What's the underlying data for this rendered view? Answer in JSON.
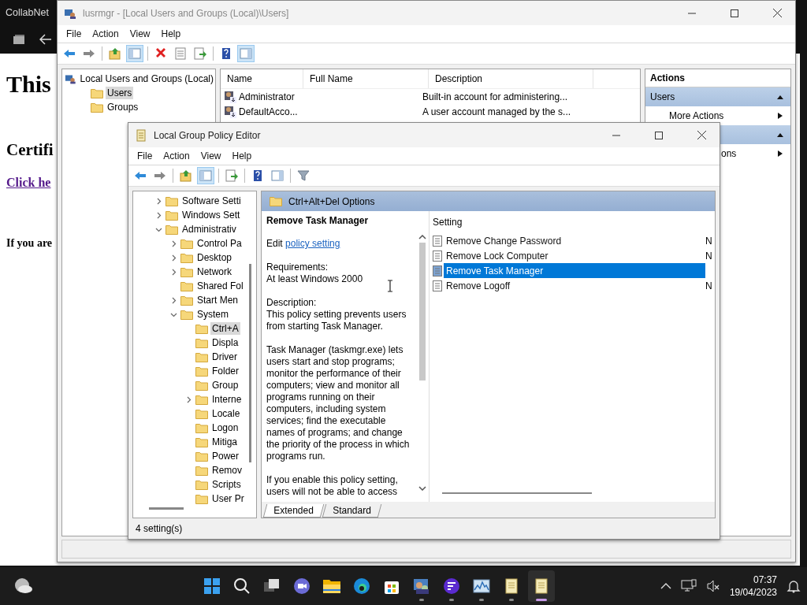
{
  "browser": {
    "tab_title": "CollabNet",
    "content": [
      {
        "kind": "h1",
        "text": "This"
      },
      {
        "kind": "h2",
        "text": "Certifi"
      },
      {
        "kind": "link",
        "text": "Click he"
      },
      {
        "kind": "para",
        "text": "If you are"
      }
    ]
  },
  "lusrmgr": {
    "title": "lusrmgr - [Local Users and Groups (Local)\\Users]",
    "menu": [
      "File",
      "Action",
      "View",
      "Help"
    ],
    "toolbar": [
      {
        "kind": "back",
        "pressed": false
      },
      {
        "kind": "forward",
        "pressed": false
      },
      {
        "kind": "sep"
      },
      {
        "kind": "up",
        "pressed": false
      },
      {
        "kind": "tree",
        "pressed": true
      },
      {
        "kind": "sep"
      },
      {
        "kind": "delete",
        "pressed": false
      },
      {
        "kind": "properties",
        "pressed": false
      },
      {
        "kind": "export",
        "pressed": false
      },
      {
        "kind": "sep"
      },
      {
        "kind": "help",
        "pressed": false
      },
      {
        "kind": "actionpane",
        "pressed": true
      }
    ],
    "tree": [
      {
        "label": "Local Users and Groups (Local)",
        "kind": "root",
        "selected": false,
        "children": [
          {
            "label": "Users",
            "kind": "folder",
            "selected": true
          },
          {
            "label": "Groups",
            "kind": "folder",
            "selected": false
          }
        ]
      }
    ],
    "columns": [
      "Name",
      "Full Name",
      "Description"
    ],
    "rows": [
      {
        "name": "Administrator",
        "description": "Built-in account for administering..."
      },
      {
        "name": "DefaultAcco...",
        "description": "A user account managed by the s..."
      }
    ],
    "actions": {
      "title": "Actions",
      "sections": [
        {
          "label": "Users",
          "expanded": true,
          "items": [
            "More Actions"
          ]
        },
        {
          "expanded": true,
          "items": [
            "ons"
          ]
        }
      ]
    }
  },
  "gpedit": {
    "title": "Local Group Policy Editor",
    "menu": [
      "File",
      "Action",
      "View",
      "Help"
    ],
    "toolbar": [
      {
        "kind": "back",
        "pressed": false
      },
      {
        "kind": "forward",
        "pressed": false
      },
      {
        "kind": "sep"
      },
      {
        "kind": "up",
        "pressed": false
      },
      {
        "kind": "tree",
        "pressed": true
      },
      {
        "kind": "sep"
      },
      {
        "kind": "export",
        "pressed": false
      },
      {
        "kind": "sep"
      },
      {
        "kind": "help",
        "pressed": false
      },
      {
        "kind": "actionpane",
        "pressed": false
      },
      {
        "kind": "sep"
      },
      {
        "kind": "filter",
        "pressed": false
      }
    ],
    "tree": [
      {
        "label": "Software Setti",
        "kind": "branch",
        "expanded": false,
        "selected": false
      },
      {
        "label": "Windows Sett",
        "kind": "branch",
        "expanded": false,
        "selected": false
      },
      {
        "label": "Administrativ",
        "kind": "branch",
        "expanded": true,
        "selected": false,
        "children": [
          {
            "label": "Control Pa",
            "kind": "branch",
            "expanded": false,
            "selected": false
          },
          {
            "label": "Desktop",
            "kind": "branch",
            "expanded": false,
            "selected": false
          },
          {
            "label": "Network",
            "kind": "branch",
            "expanded": false,
            "selected": false
          },
          {
            "label": "Shared Fol",
            "kind": "folder",
            "selected": false
          },
          {
            "label": "Start Men",
            "kind": "branch",
            "expanded": false,
            "selected": false
          },
          {
            "label": "System",
            "kind": "branch",
            "expanded": true,
            "selected": false,
            "children": [
              {
                "label": "Ctrl+A",
                "kind": "folder",
                "selected": true
              },
              {
                "label": "Displa",
                "kind": "folder",
                "selected": false
              },
              {
                "label": "Driver",
                "kind": "folder",
                "selected": false
              },
              {
                "label": "Folder",
                "kind": "folder",
                "selected": false
              },
              {
                "label": "Group",
                "kind": "folder",
                "selected": false
              },
              {
                "label": "Interne",
                "kind": "branch",
                "expanded": false,
                "selected": false
              },
              {
                "label": "Locale",
                "kind": "folder",
                "selected": false
              },
              {
                "label": "Logon",
                "kind": "folder",
                "selected": false
              },
              {
                "label": "Mitiga",
                "kind": "folder",
                "selected": false
              },
              {
                "label": "Power",
                "kind": "folder",
                "selected": false
              },
              {
                "label": "Remov",
                "kind": "folder",
                "selected": false
              },
              {
                "label": "Scripts",
                "kind": "folder",
                "selected": false
              },
              {
                "label": "User Pr",
                "kind": "folder",
                "selected": false
              }
            ]
          }
        ]
      }
    ],
    "header": "Ctrl+Alt+Del Options",
    "description": {
      "title": "Remove Task Manager",
      "edit_prefix": "Edit",
      "edit_link": "policy setting",
      "blocks": [
        [
          "Requirements:",
          "At least Windows 2000"
        ],
        [
          "Description:",
          "This policy setting prevents users from starting Task Manager."
        ],
        [
          "Task Manager (taskmgr.exe) lets users start and stop programs; monitor the performance of their computers; view and monitor all programs running on their computers, including system services; find the executable names of programs; and change the priority of the process in which programs run."
        ],
        [
          "If you enable this policy setting, users will not be able to access"
        ]
      ]
    },
    "settings_column": "Setting",
    "settings": [
      {
        "name": "Remove Change Password",
        "column_2": "N",
        "selected": false
      },
      {
        "name": "Remove Lock Computer",
        "column_2": "N",
        "selected": false
      },
      {
        "name": "Remove Task Manager",
        "selected": true
      },
      {
        "name": "Remove Logoff",
        "column_2": "N",
        "selected": false
      }
    ],
    "tabs": [
      {
        "label": "Extended",
        "selected": true
      },
      {
        "label": "Standard",
        "selected": false
      }
    ],
    "status": "4 setting(s)"
  },
  "taskbar": {
    "apps": [
      {
        "kind": "start",
        "running": false,
        "active": false
      },
      {
        "kind": "search",
        "running": false,
        "active": false
      },
      {
        "kind": "taskview",
        "running": false,
        "active": false
      },
      {
        "kind": "chat",
        "running": false,
        "active": false
      },
      {
        "kind": "explorer",
        "running": false,
        "active": false
      },
      {
        "kind": "edge",
        "running": false,
        "active": false
      },
      {
        "kind": "store",
        "running": false,
        "active": false
      },
      {
        "kind": "users",
        "running": true,
        "active": false
      },
      {
        "kind": "purple",
        "running": true,
        "active": false
      },
      {
        "kind": "monitor",
        "running": true,
        "active": false
      },
      {
        "kind": "scroll",
        "running": true,
        "active": false
      },
      {
        "kind": "scroll",
        "running": true,
        "active": true
      }
    ],
    "time": "07:37",
    "date": "19/04/2023"
  }
}
